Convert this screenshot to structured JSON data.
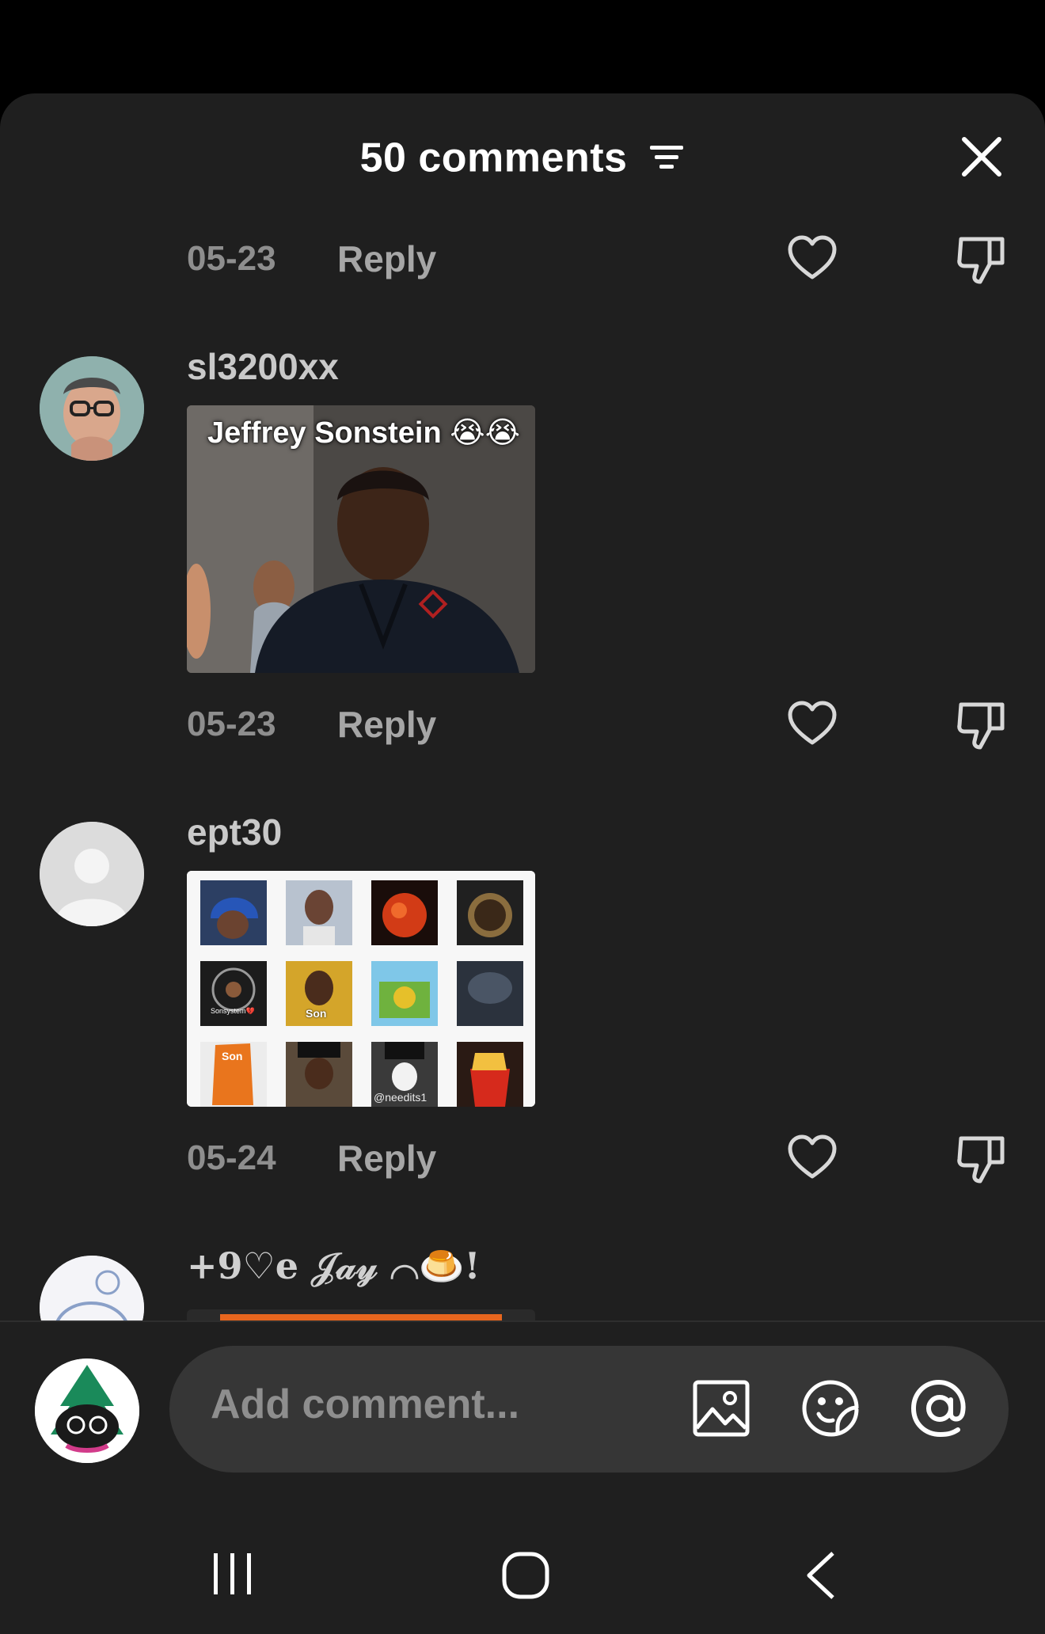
{
  "header": {
    "title": "50 comments"
  },
  "comments": [
    {
      "date": "05-23",
      "reply_label": "Reply"
    },
    {
      "username": "sl3200xx",
      "image_caption": "Jeffrey Sonstein 😭😭",
      "date": "05-23",
      "reply_label": "Reply"
    },
    {
      "username": "ept30",
      "image_grid_labels": [
        "Sonsystem💔",
        "Son",
        "Son",
        "@needits1"
      ],
      "date": "05-24",
      "reply_label": "Reply"
    },
    {
      "username": "+9♡e 𝒥𝒶𝓎 ⌒🍮!"
    }
  ],
  "composer": {
    "placeholder": "Add comment..."
  },
  "icons": {
    "sort": "sort-lines-icon",
    "close": "close-icon",
    "like": "heart-outline-icon",
    "dislike": "thumbs-down-icon",
    "image": "image-icon",
    "sticker": "sticker-icon",
    "mention": "at-sign-icon",
    "nav": [
      "recents-icon",
      "home-icon",
      "back-icon"
    ]
  },
  "colors": {
    "sheet_bg": "#1f1f1f",
    "input_bg": "#363636",
    "muted_text": "#8e8e8e"
  }
}
